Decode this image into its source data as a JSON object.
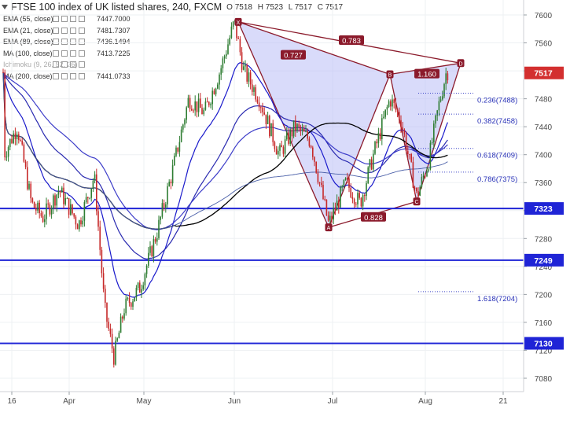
{
  "header": {
    "title": "FTSE 100 index of UK listed shares, 240, FXCM",
    "ohlc": {
      "o": "O 7518",
      "h": "H 7523",
      "l": "L 7517",
      "c": "C 7517"
    }
  },
  "indicators": [
    {
      "name": "EMA (55, close)",
      "value": "7447.7000",
      "dim": false
    },
    {
      "name": "EMA (21, close)",
      "value": "7481.7307",
      "dim": false
    },
    {
      "name": "EMA (89, close)",
      "value": "7436.1494",
      "dim": false
    },
    {
      "name": "MA (100, close)",
      "value": "7413.7225",
      "dim": false
    },
    {
      "name": "Ichimoku (9, 26, 52, 26)",
      "value": "",
      "dim": true
    },
    {
      "name": "MA (200, close)",
      "value": "7441.0733",
      "dim": false
    }
  ],
  "chart_data": {
    "type": "candlestick",
    "y_axis": {
      "ticks": [
        7600,
        7560,
        7520,
        7480,
        7440,
        7400,
        7360,
        7320,
        7280,
        7240,
        7200,
        7160,
        7120,
        7080
      ],
      "ylim": [
        7062,
        7620
      ]
    },
    "x_axis": {
      "tick_labels": [
        "16",
        "Apr",
        "May",
        "Jun",
        "Jul",
        "Aug",
        "21"
      ]
    },
    "current_price": "7517",
    "price_labels": [
      "7323",
      "7249",
      "7130"
    ],
    "horizontal_levels": [
      7323,
      7249,
      7130
    ],
    "fibonacci_levels": [
      {
        "label": "0.236(7488)",
        "value": 7488
      },
      {
        "label": "0.382(7458)",
        "value": 7458
      },
      {
        "label": "0.618(7409)",
        "value": 7409
      },
      {
        "label": "0.786(7375)",
        "value": 7375
      },
      {
        "label": "1.618(7204)",
        "value": 7204
      }
    ],
    "pattern_labels": [
      "0.727",
      "0.783",
      "0.828",
      "1.160"
    ],
    "pattern_points": [
      "X",
      "A",
      "B",
      "C",
      "D"
    ],
    "colors": {
      "up": "#2e7d32",
      "down": "#c62828",
      "level": "#1f24d6",
      "pattern": "#8b1a2b",
      "pattern_fill": "#b9bdf5",
      "ema21": "#1a1acb",
      "ema55": "#2a2ab0",
      "ema89": "#3d3dc9",
      "ma100": "#000000",
      "ma200": "#4a5fa8",
      "price_tag": "#d32f2f"
    }
  }
}
